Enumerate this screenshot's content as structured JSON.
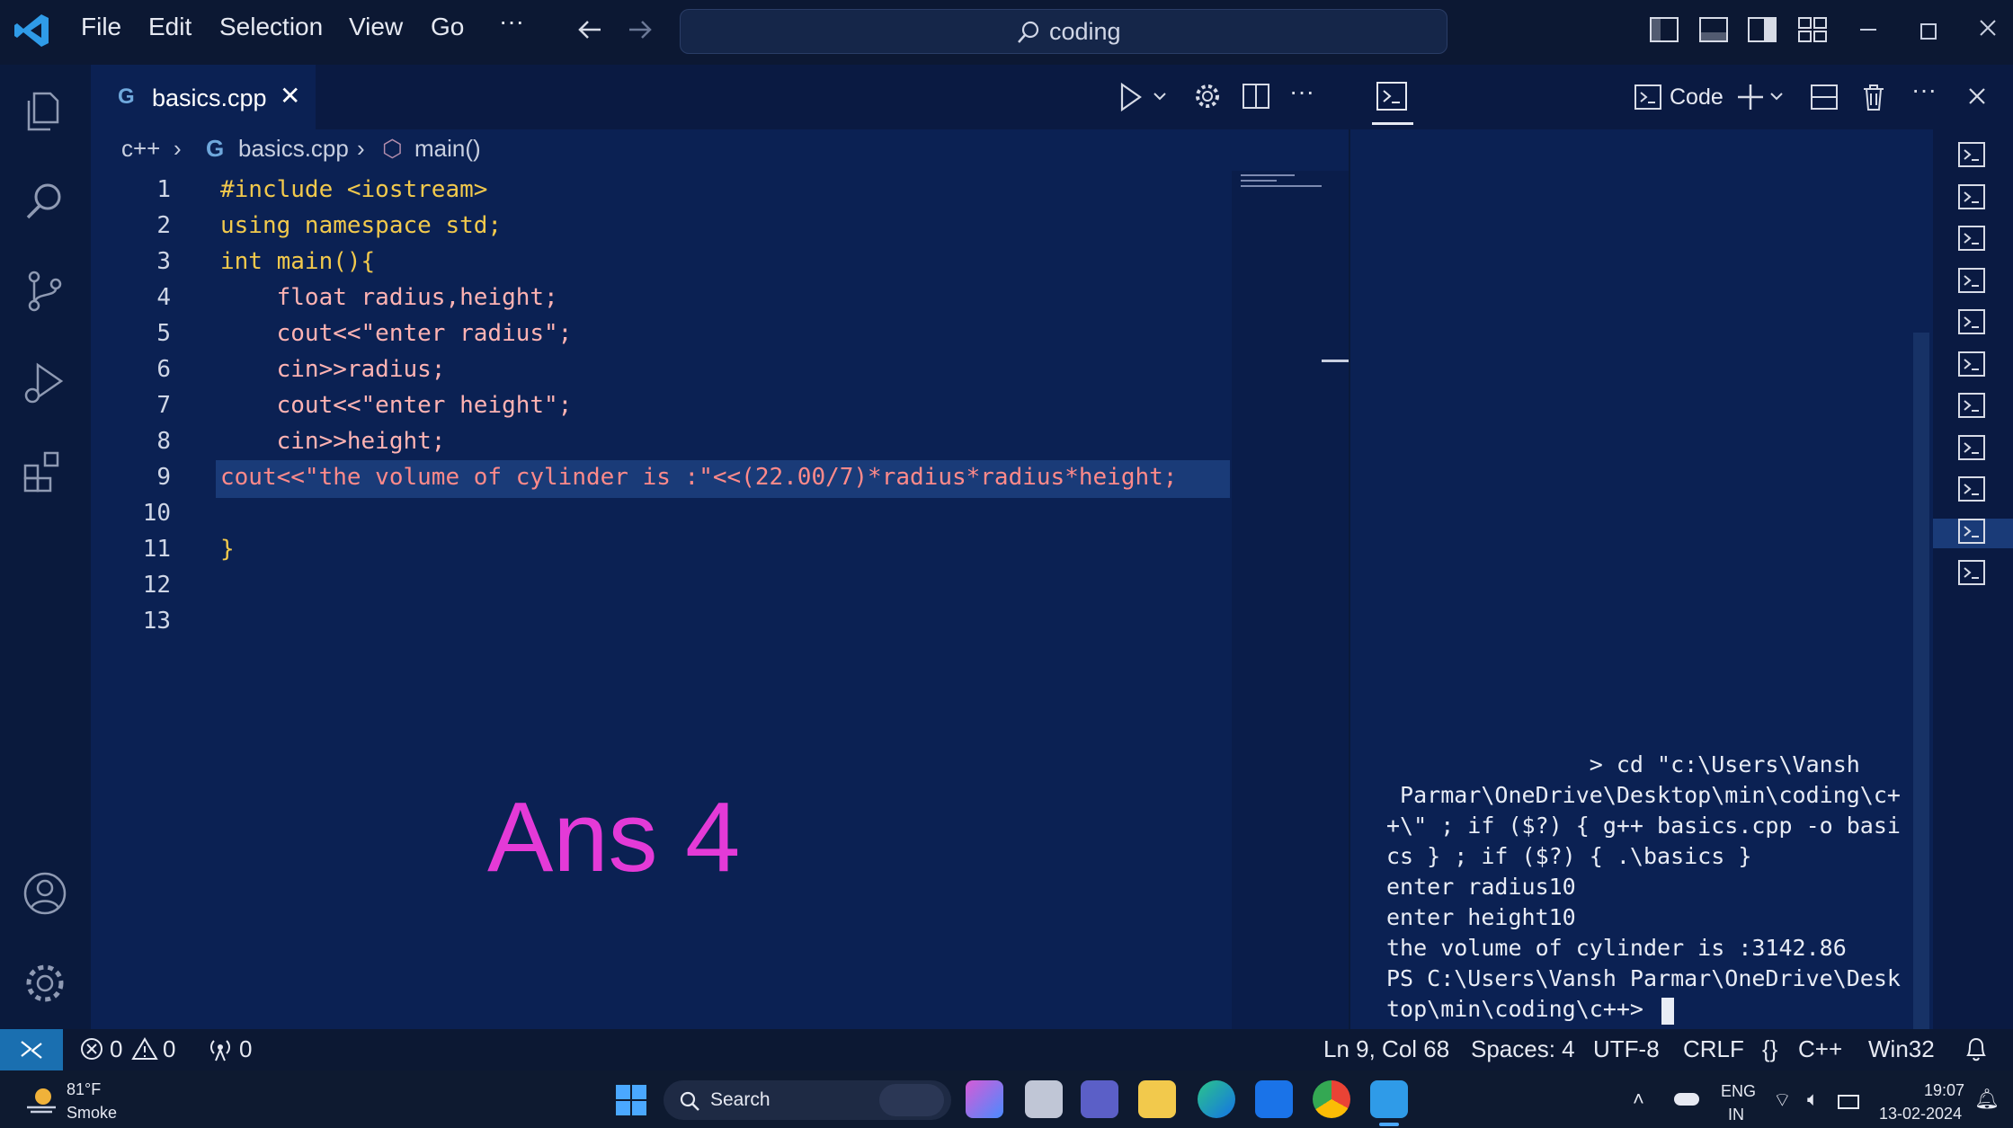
{
  "titlebar": {
    "menu": [
      "File",
      "Edit",
      "Selection",
      "View",
      "Go",
      "···"
    ],
    "search_text": "coding"
  },
  "tab": {
    "name": "basics.cpp",
    "close": "✕"
  },
  "breadcrumb": {
    "folder": "c++",
    "file": "basics.cpp",
    "symbol": "main()"
  },
  "editor": {
    "line_numbers": [
      "1",
      "2",
      "3",
      "4",
      "5",
      "6",
      "7",
      "8",
      "9",
      "10",
      "11",
      "12",
      "13"
    ],
    "lines": [
      "#include <iostream>",
      "using namespace std;",
      "int main(){",
      "    float radius,height;",
      "    cout<<\"enter radius\";",
      "    cin>>radius;",
      "    cout<<\"enter height\";",
      "    cin>>height;",
      "cout<<\"the volume of cylinder is :\"<<(22.00/7)*radius*radius*height;",
      "",
      "}",
      "",
      ""
    ],
    "annotation": "Ans 4"
  },
  "panel": {
    "terminal_label": "Code"
  },
  "terminal": {
    "lines": [
      "               > cd \"c:\\Users\\Vansh",
      " Parmar\\OneDrive\\Desktop\\min\\coding\\c+",
      "+\\\" ; if ($?) { g++ basics.cpp -o basi",
      "cs } ; if ($?) { .\\basics }",
      "enter radius10",
      "enter height10",
      "the volume of cylinder is :3142.86",
      "PS C:\\Users\\Vansh Parmar\\OneDrive\\Desk",
      "top\\min\\coding\\c++> "
    ]
  },
  "status": {
    "errors": "0",
    "warnings": "0",
    "ports": "0",
    "position": "Ln 9, Col 68",
    "spaces": "Spaces: 4",
    "encoding": "UTF-8",
    "eol": "CRLF",
    "language": "C++",
    "platform": "Win32"
  },
  "taskbar": {
    "weather_temp": "81°F",
    "weather_desc": "Smoke",
    "search_label": "Search",
    "lang_top": "ENG",
    "lang_bottom": "IN",
    "time": "19:07",
    "date": "13-02-2024"
  },
  "colors": {
    "accent": "#1a6fb0",
    "annotation": "#e43ad7",
    "keyword": "#f2c94c",
    "string": "#ff8a8a",
    "identifier": "#ffb3b3"
  }
}
